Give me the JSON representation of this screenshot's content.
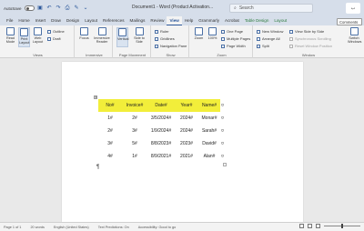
{
  "titlebar": {
    "autosave": "AutoSave",
    "autosave_state": "Off",
    "doc_title": "Document1 - Word (Product Activation...",
    "search_placeholder": "Search",
    "avatar_initials": "ب"
  },
  "tabs": [
    "File",
    "Home",
    "Insert",
    "Draw",
    "Design",
    "Layout",
    "References",
    "Mailings",
    "Review",
    "View",
    "Help",
    "Grammarly",
    "Acrobat",
    "Table Design",
    "Layout"
  ],
  "active_tab": "View",
  "comments_label": "Comments",
  "ribbon": {
    "views": {
      "read_mode": "Read Mode",
      "print_layout": "Print Layout",
      "web_layout": "Web Layout",
      "outline": "Outline",
      "draft": "Draft",
      "label": "Views"
    },
    "immersive": {
      "focus": "Focus",
      "immersive_reader": "Immersive Reader",
      "label": "Immersive"
    },
    "page_movement": {
      "vertical": "Vertical",
      "side_to_side": "Side to Side",
      "label": "Page Movement"
    },
    "show": {
      "ruler": "Ruler",
      "gridlines": "Gridlines",
      "navigation_pane": "Navigation Pane",
      "label": "Show"
    },
    "zoom": {
      "zoom": "Zoom",
      "hundred": "100%",
      "one_page": "One Page",
      "multiple_pages": "Multiple Pages",
      "page_width": "Page Width",
      "label": "Zoom"
    },
    "window": {
      "new_window": "New Window",
      "arrange_all": "Arrange All",
      "split": "Split",
      "view_side_by_side": "View Side by Side",
      "synchronous_scrolling": "Synchronous Scrolling",
      "reset_window_position": "Reset Window Position",
      "switch_windows": "Switch Windows",
      "label": "Window"
    }
  },
  "table": {
    "headers": [
      "No#",
      "Invoice#",
      "Date#",
      "Year#",
      "Name#"
    ],
    "rows": [
      [
        "1#",
        "2#",
        "3/5/2024#",
        "2024#",
        "Monar#"
      ],
      [
        "2#",
        "3#",
        "1/9/2024#",
        "2024#",
        "Sarah#"
      ],
      [
        "3#",
        "5#",
        "8/8/2023#",
        "2023#",
        "David#"
      ],
      [
        "4#",
        "1#",
        "8/9/2021#",
        "2021#",
        "Alan#"
      ]
    ],
    "row_end_mark": "¤",
    "header_color": "#f2ee3a"
  },
  "statusbar": {
    "page": "Page 1 of 1",
    "words": "20 words",
    "language": "English (United States)",
    "text_predictions": "Text Predictions: On",
    "accessibility": "Accessibility: Good to go"
  },
  "colors": {
    "accent": "#2b579a",
    "ribbon_bg": "#f3f3f3",
    "titlebar_bg": "#d6deea"
  }
}
